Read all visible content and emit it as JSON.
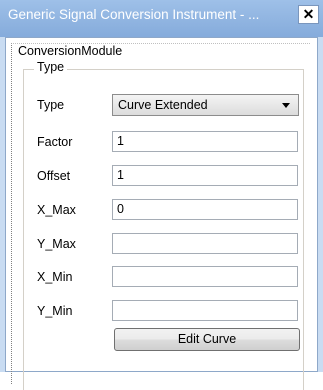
{
  "window": {
    "title": "Generic Signal Conversion Instrument - ...",
    "close_glyph": "✕"
  },
  "module": {
    "label": "ConversionModule",
    "group_title": "Type"
  },
  "fields": {
    "type": {
      "label": "Type",
      "value": "Curve Extended"
    },
    "factor": {
      "label": "Factor",
      "value": "1"
    },
    "offset": {
      "label": "Offset",
      "value": "1"
    },
    "x_max": {
      "label": "X_Max",
      "value": "0"
    },
    "y_max": {
      "label": "Y_Max",
      "value": ""
    },
    "x_min": {
      "label": "X_Min",
      "value": ""
    },
    "y_min": {
      "label": "Y_Min",
      "value": ""
    }
  },
  "buttons": {
    "edit_curve": "Edit Curve"
  },
  "colors": {
    "titlebar": "#9ec0e8",
    "frame": "#c9dcf2"
  }
}
